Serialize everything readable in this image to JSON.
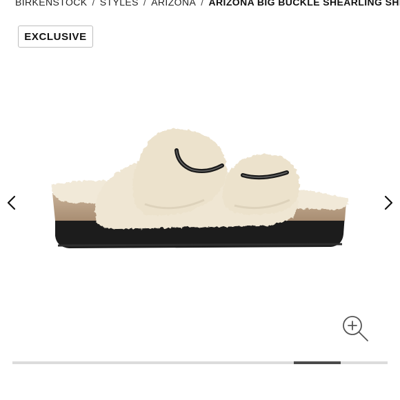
{
  "breadcrumb": {
    "items": [
      "BIRKENSTOCK",
      "STYLES",
      "ARIZONA"
    ],
    "current": "ARIZONA BIG BUCKLE SHEARLING SHEARLING",
    "separator": "/"
  },
  "badge": {
    "label": "EXCLUSIVE"
  },
  "carousel": {
    "prev_icon": "chevron-left-icon",
    "next_icon": "chevron-right-icon",
    "zoom_icon": "zoom-in-icon",
    "slide_count": 8,
    "current_index": 6
  },
  "colors": {
    "text": "#111111",
    "badge_border": "#bdbdbd",
    "track": "#dcdcdc",
    "thumb": "#4a4a4a",
    "shearling": "#efe6d3",
    "cork": "#b69b80",
    "sole": "#1c1c1c"
  }
}
